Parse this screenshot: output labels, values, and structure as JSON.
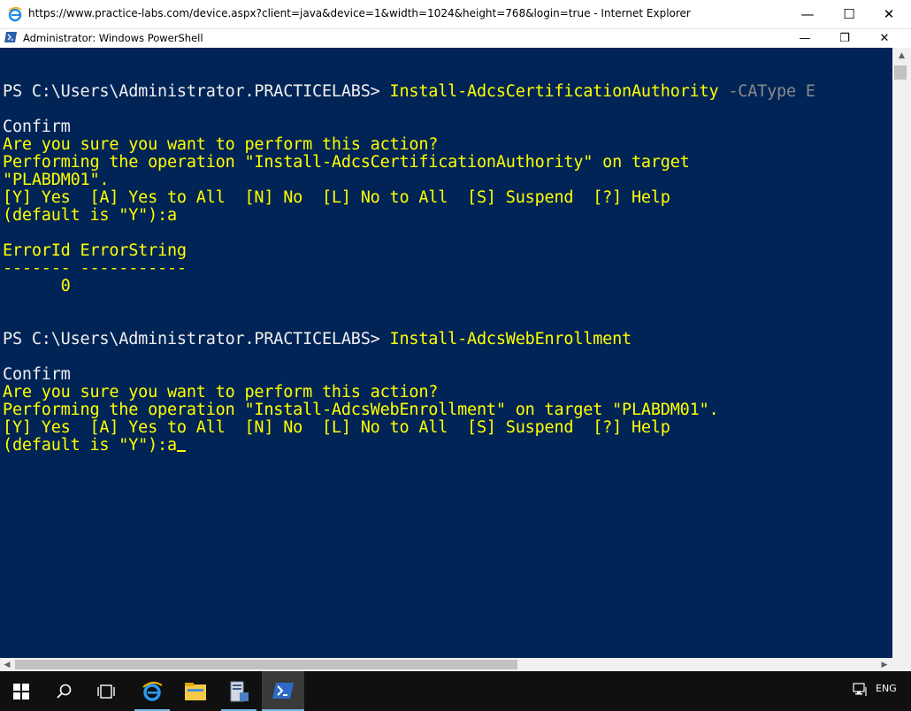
{
  "browser": {
    "title": "https://www.practice-labs.com/device.aspx?client=java&device=1&width=1024&height=768&login=true - Internet Explorer",
    "minimize": "—",
    "maximize": "☐",
    "close": "✕"
  },
  "window": {
    "title": "Administrator: Windows PowerShell",
    "minimize": "—",
    "restore": "❐",
    "close": "✕"
  },
  "console": {
    "prompt1": "PS C:\\Users\\Administrator.PRACTICELABS> ",
    "cmd1": "Install-AdcsCertificationAuthority",
    "cmd1_param": " -CAType E",
    "confirm1": "Confirm",
    "q1": "Are you sure you want to perform this action?",
    "op1a": "Performing the operation \"Install-AdcsCertificationAuthority\" on target",
    "op1b": "\"PLABDM01\".",
    "choices1": "[Y] Yes  [A] Yes to All  [N] No  [L] No to All  [S] Suspend  ",
    "help1": "[?] Help",
    "default1": "(default is \"Y\"):a",
    "hdr": "ErrorId ErrorString",
    "sep": "------- -----------",
    "val": "      0",
    "prompt2": "PS C:\\Users\\Administrator.PRACTICELABS> ",
    "cmd2": "Install-AdcsWebEnrollment",
    "confirm2": "Confirm",
    "q2": "Are you sure you want to perform this action?",
    "op2": "Performing the operation \"Install-AdcsWebEnrollment\" on target \"PLABDM01\".",
    "choices2": "[Y] Yes  [A] Yes to All  [N] No  [L] No to All  [S] Suspend  ",
    "help2": "[?] Help",
    "default2": "(default is \"Y\"):a"
  },
  "colors": {
    "console_bg": "#012456",
    "prompt_fg": "#f0f0f0",
    "warning_fg": "#ffff00",
    "param_fg": "#8a8a8a"
  },
  "taskbar": {
    "items": [
      "start-icon",
      "search-icon",
      "task-view-icon",
      "internet-explorer-icon",
      "file-explorer-icon",
      "server-manager-icon",
      "powershell-icon"
    ],
    "language": "ENG"
  }
}
